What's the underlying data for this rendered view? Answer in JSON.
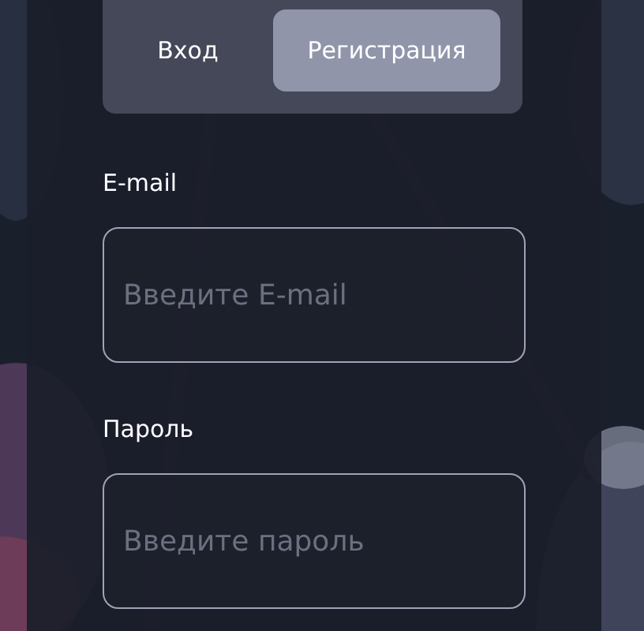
{
  "tabs": [
    {
      "label": "Вход",
      "selected": false
    },
    {
      "label": "Регистрация",
      "selected": true
    }
  ],
  "fields": [
    {
      "label": "E-mail",
      "placeholder": "Введите E-mail"
    },
    {
      "label": "Пароль",
      "placeholder": "Введите пароль"
    }
  ]
}
